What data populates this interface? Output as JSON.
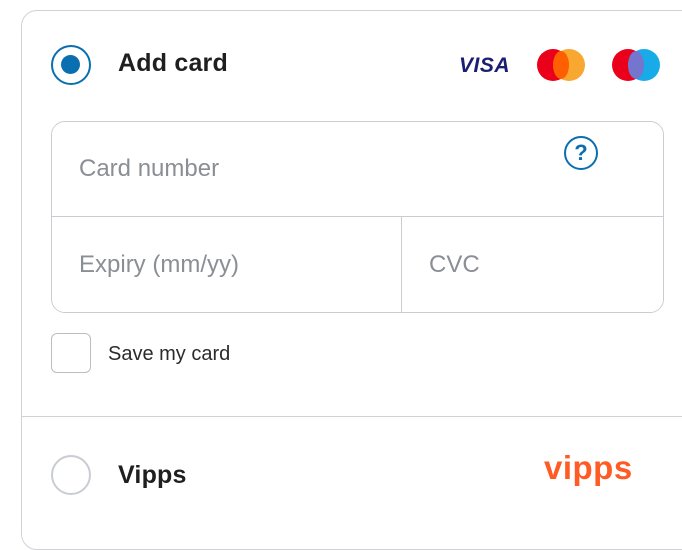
{
  "payment_methods": {
    "card": {
      "title": "Add card",
      "selected": true,
      "brands": {
        "visa": "VISA",
        "mastercard_icon": "mastercard-icon",
        "maestro_icon": "maestro-icon"
      },
      "fields": {
        "card_number_placeholder": "Card number",
        "expiry_placeholder": "Expiry (mm/yy)",
        "cvc_placeholder": "CVC",
        "help_icon": "question-mark-circle-icon",
        "help_glyph": "?"
      },
      "save_card": {
        "label": "Save my card",
        "checked": false
      }
    },
    "vipps": {
      "title": "Vipps",
      "selected": false,
      "logo_text": "vipps"
    }
  },
  "colors": {
    "accent": "#0a6fb0",
    "border": "#c9cdd2",
    "vipps_brand": "#ff5b24",
    "visa_brand": "#1a1f71"
  }
}
